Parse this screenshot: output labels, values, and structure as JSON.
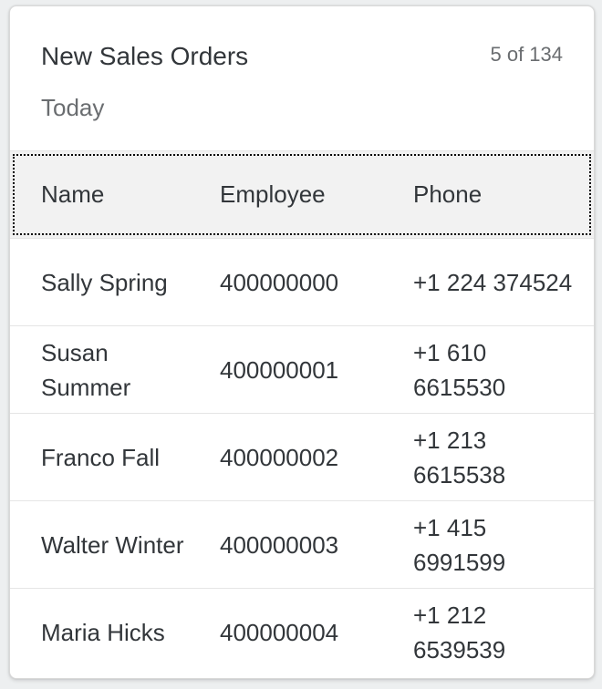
{
  "card": {
    "title": "New Sales Orders",
    "counter": "5 of 134",
    "subtitle": "Today"
  },
  "table": {
    "headers": [
      "Name",
      "Employee",
      "Phone"
    ],
    "rows": [
      {
        "name": "Sally Spring",
        "employee": "400000000",
        "phone": "+1 224 374524"
      },
      {
        "name": "Susan Summer",
        "employee": "400000001",
        "phone": "+1 610 6615530"
      },
      {
        "name": "Franco Fall",
        "employee": "400000002",
        "phone": "+1 213 6615538"
      },
      {
        "name": "Walter Winter",
        "employee": "400000003",
        "phone": "+1 415 6991599"
      },
      {
        "name": "Maria Hicks",
        "employee": "400000004",
        "phone": "+1 212 6539539"
      }
    ]
  },
  "colors": {
    "background": "#edeff0",
    "card": "#ffffff",
    "text": "#32363a",
    "muted": "#6a6d70",
    "header_bg": "#f2f2f2",
    "divider": "#e5e5e5"
  }
}
